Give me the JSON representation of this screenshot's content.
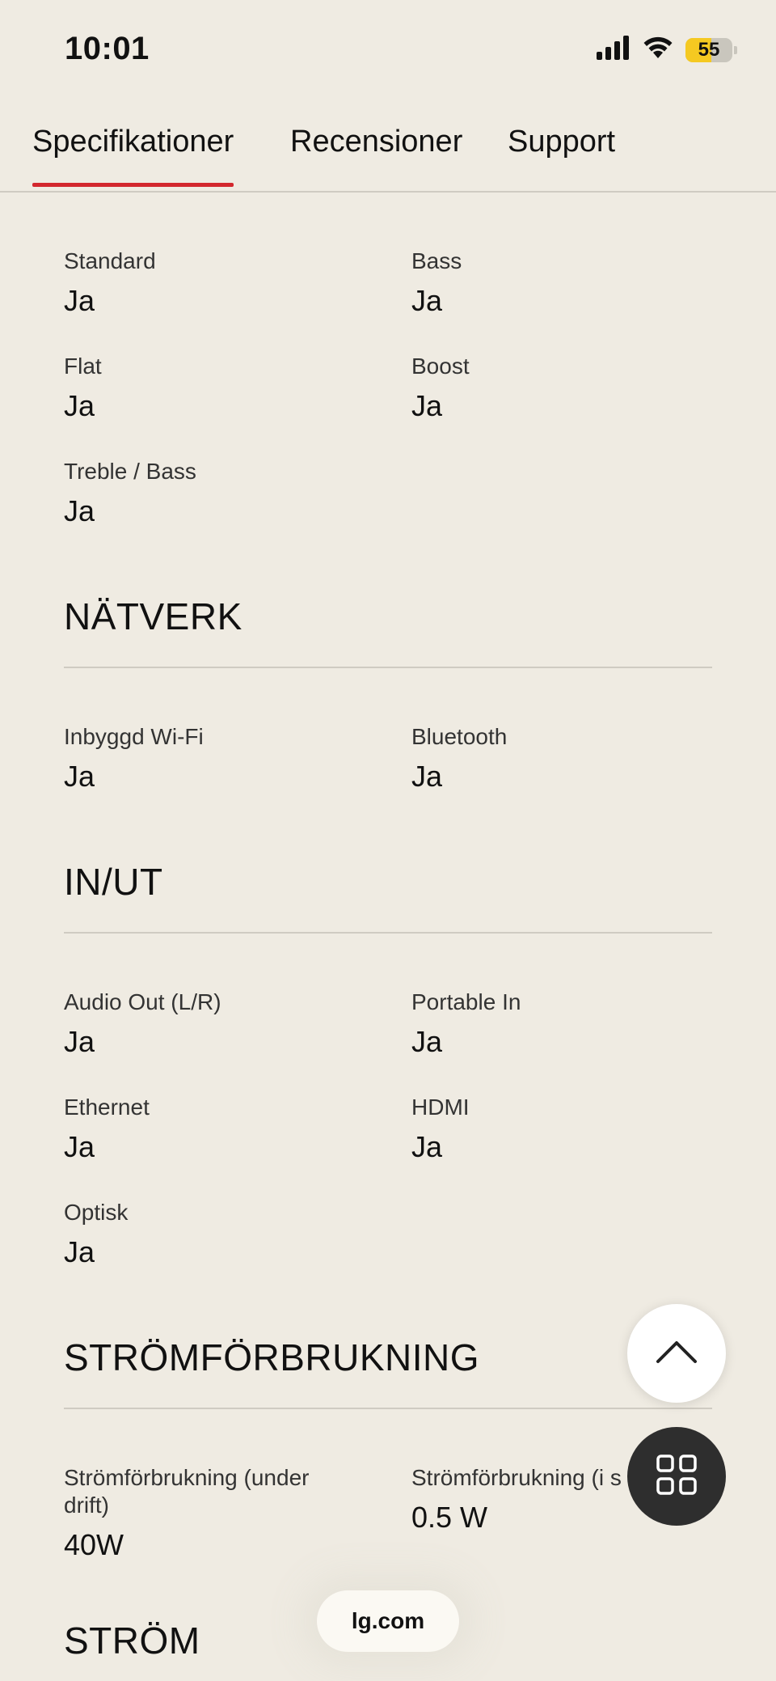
{
  "status_bar": {
    "time": "10:01",
    "battery_level": "55",
    "battery_fraction": 0.55,
    "icons": [
      "signal-icon",
      "wifi-icon",
      "battery-icon"
    ]
  },
  "tabs": [
    {
      "label": "Specifikationer",
      "active": true
    },
    {
      "label": "Recensioner",
      "active": false
    },
    {
      "label": "Support",
      "active": false
    }
  ],
  "sound_modes": {
    "items": [
      {
        "label": "Standard",
        "value": "Ja"
      },
      {
        "label": "Bass",
        "value": "Ja"
      },
      {
        "label": "Flat",
        "value": "Ja"
      },
      {
        "label": "Boost",
        "value": "Ja"
      },
      {
        "label": "Treble / Bass",
        "value": "Ja"
      }
    ]
  },
  "network": {
    "title": "NÄTVERK",
    "items": [
      {
        "label": "Inbyggd Wi-Fi",
        "value": "Ja"
      },
      {
        "label": "Bluetooth",
        "value": "Ja"
      }
    ]
  },
  "io": {
    "title": "IN/UT",
    "items": [
      {
        "label": "Audio Out (L/R)",
        "value": "Ja"
      },
      {
        "label": "Portable In",
        "value": "Ja"
      },
      {
        "label": "Ethernet",
        "value": "Ja"
      },
      {
        "label": "HDMI",
        "value": "Ja"
      },
      {
        "label": "Optisk",
        "value": "Ja"
      }
    ]
  },
  "power_consumption": {
    "title": "STRÖMFÖRBRUKNING",
    "items": [
      {
        "label": "Strömförbrukning (under drift)",
        "value": "40W"
      },
      {
        "label": "Strömförbrukning (i s",
        "value": "0.5 W"
      }
    ]
  },
  "power": {
    "title": "STRÖM"
  },
  "url_pill": {
    "label": "lg.com"
  },
  "colors": {
    "background": "#efebe2",
    "accent": "#d3272e",
    "battery": "#f5c921",
    "fab_dark": "#2e2e2e"
  }
}
